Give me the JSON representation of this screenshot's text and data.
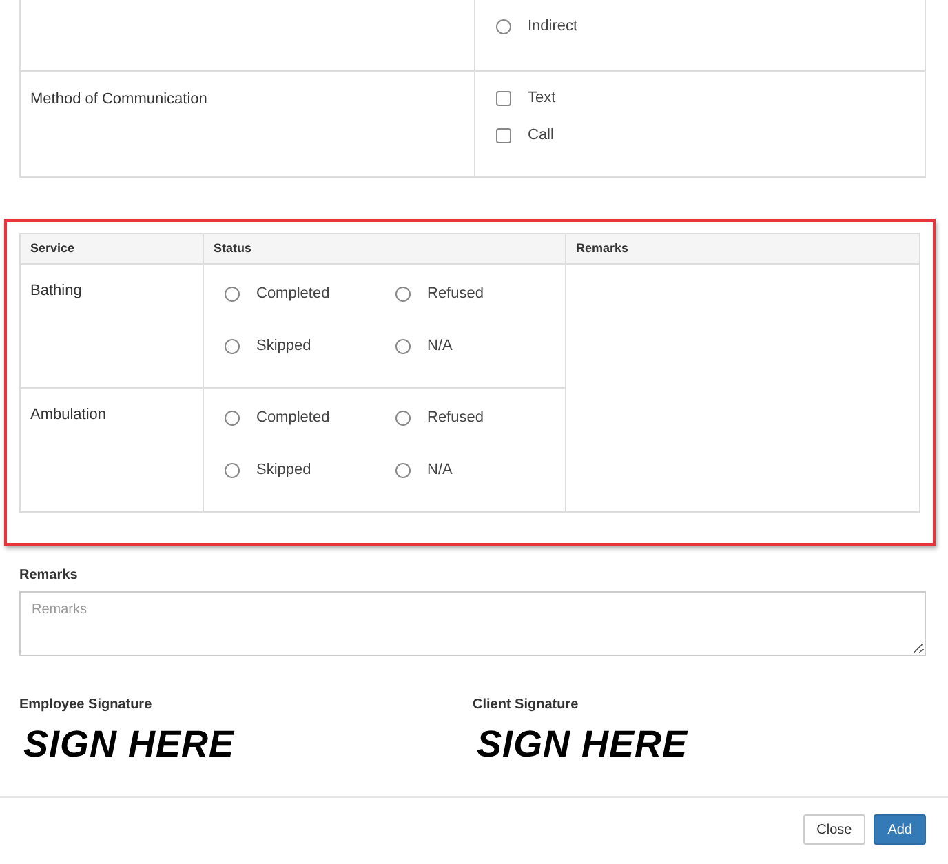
{
  "contact_table": {
    "rows": [
      {
        "label": "",
        "options": [
          {
            "kind": "radio",
            "label": "Indirect",
            "checked": false
          }
        ]
      },
      {
        "label": "Method of Communication",
        "options": [
          {
            "kind": "checkbox",
            "label": "Text",
            "checked": false
          },
          {
            "kind": "checkbox",
            "label": "Call",
            "checked": false
          }
        ]
      }
    ]
  },
  "service_table": {
    "columns": [
      "Service",
      "Status",
      "Remarks"
    ],
    "rows": [
      {
        "service": "Bathing",
        "options": [
          {
            "label": "Completed",
            "selected": false
          },
          {
            "label": "Refused",
            "selected": false
          },
          {
            "label": "Skipped",
            "selected": false
          },
          {
            "label": "N/A",
            "selected": false
          }
        ]
      },
      {
        "service": "Ambulation",
        "options": [
          {
            "label": "Completed",
            "selected": false
          },
          {
            "label": "Refused",
            "selected": false
          },
          {
            "label": "Skipped",
            "selected": false
          },
          {
            "label": "N/A",
            "selected": false
          }
        ]
      }
    ]
  },
  "remarks": {
    "label": "Remarks",
    "placeholder": "Remarks"
  },
  "signatures": [
    {
      "label": "Employee Signature",
      "prompt": "SIGN HERE"
    },
    {
      "label": "Client Signature",
      "prompt": "SIGN HERE"
    }
  ],
  "buttons": [
    {
      "kind": "secondary",
      "label": "Close"
    },
    {
      "kind": "primary",
      "label": "Add"
    }
  ]
}
